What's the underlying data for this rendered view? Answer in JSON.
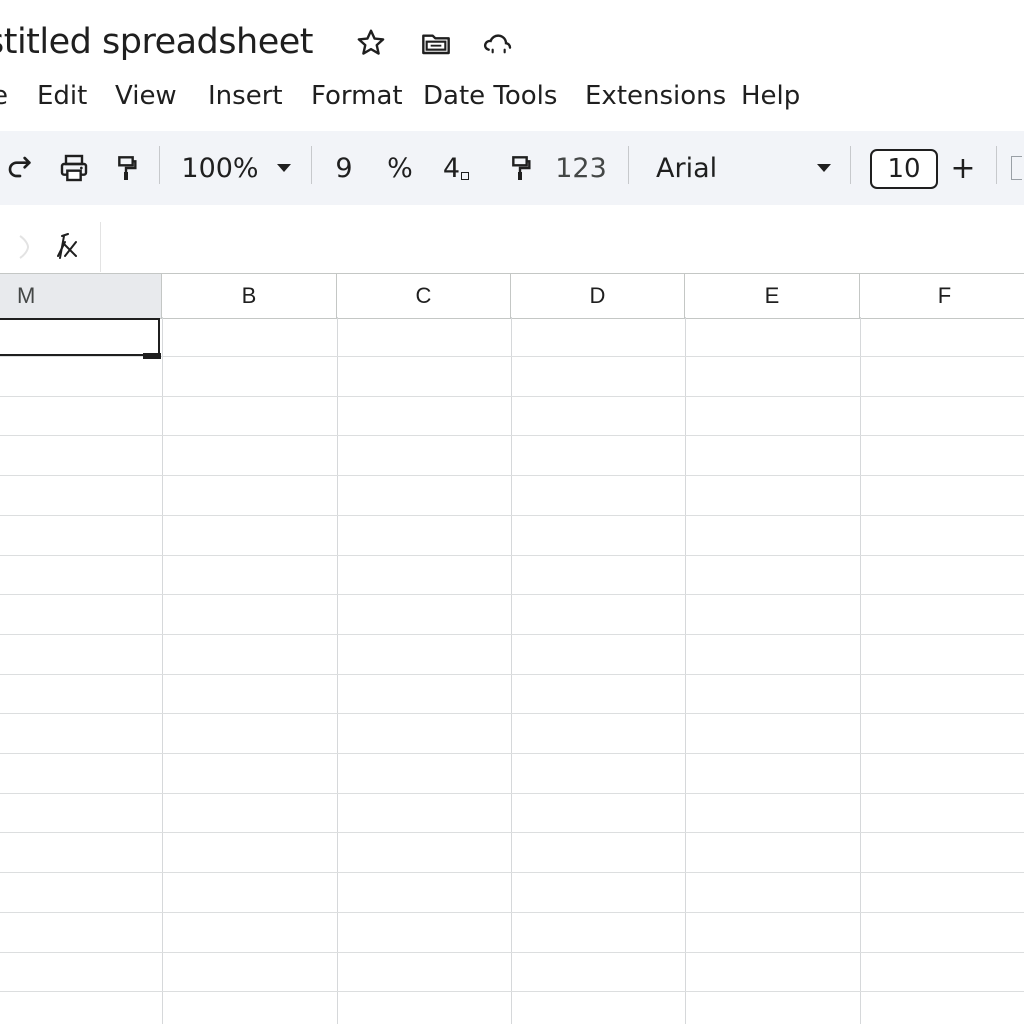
{
  "title_bar": {
    "doc_title": "stitled spreadsheet",
    "icons": [
      "star-icon",
      "move-to-folder-icon",
      "cloud-status-icon"
    ]
  },
  "menu": {
    "items": [
      "e",
      "Edit",
      "View",
      "Insert",
      "Format",
      "Date Tools",
      "Extensions",
      "Help"
    ]
  },
  "toolbar": {
    "zoom": "100%",
    "currency_label": "9",
    "percent_label": "%",
    "decimal_label": "4",
    "number_format_label": "123",
    "font_name": "Arial",
    "font_size": "10",
    "plus_label": "+"
  },
  "formula_bar": {
    "fx_icon": "function-icon"
  },
  "grid": {
    "column_headers": [
      "M",
      "B",
      "C",
      "D",
      "E",
      "F"
    ],
    "selected_column": "M",
    "row_count": 18
  },
  "colors": {
    "toolbar_bg": "#f2f4f8",
    "gridline": "#dcdedf",
    "selection_border": "#1f1f1f"
  }
}
